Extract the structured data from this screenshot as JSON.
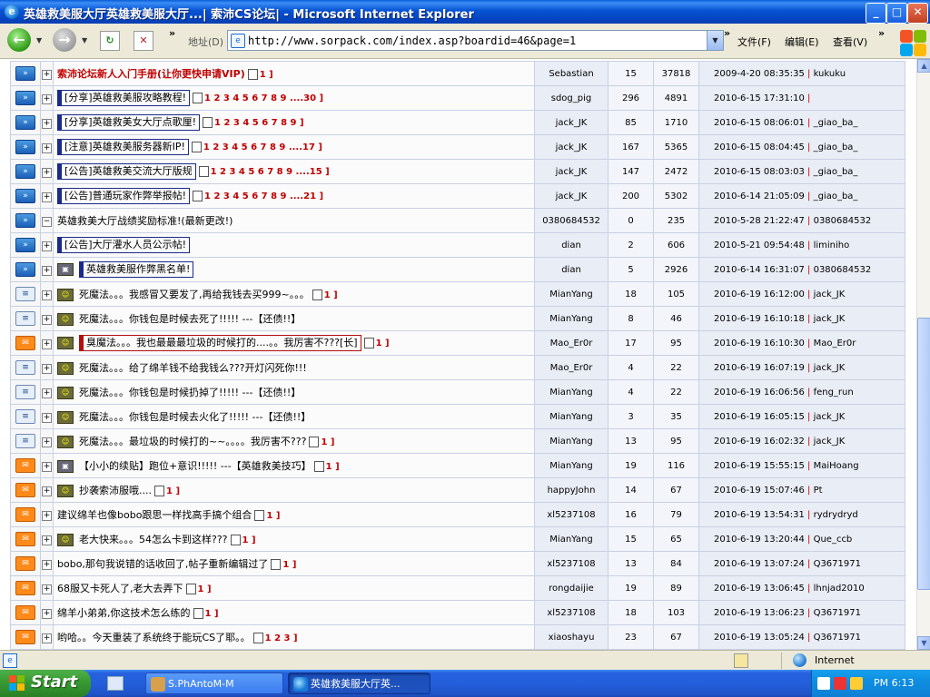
{
  "window": {
    "title": "英雄救美服大厅英雄救美服大厅...| 索沛CS论坛| - Microsoft Internet Explorer",
    "minimize": "_",
    "maximize": "□",
    "close": "✕"
  },
  "toolbar": {
    "address_label": "地址(D)",
    "url": "http://www.sorpack.com/index.asp?boardid=46&page=1",
    "menus": [
      "文件(F)",
      "编辑(E)",
      "查看(V)"
    ]
  },
  "threads": [
    {
      "icon": "green",
      "expander": "+",
      "tag": "",
      "frame": "",
      "title": "索沛论坛新人入门手册(让你更快申请VIP)",
      "title_style": "red",
      "pages": "",
      "attach": true,
      "author": "Sebastian",
      "replies": "15",
      "views": "37818",
      "last_time": "2009-4-20 08:35:35",
      "last_user": "kukuku"
    },
    {
      "icon": "green",
      "expander": "+",
      "tag": "",
      "frame": "blue",
      "title": "[分享]英雄救美服攻略教程!",
      "title_style": "",
      "pages": "1 2 3 4 5 6 7 8 9 ....30",
      "attach": false,
      "author": "sdog_pig",
      "replies": "296",
      "views": "4891",
      "last_time": "2010-6-15 17:31:10",
      "last_user": ""
    },
    {
      "icon": "green",
      "expander": "+",
      "tag": "",
      "frame": "blue",
      "title": "[分享]英雄救美女大厅点歌厘!",
      "title_style": "",
      "pages": "1 2 3 4 5 6 7 8 9",
      "attach": false,
      "author": "jack_JK",
      "replies": "85",
      "views": "1710",
      "last_time": "2010-6-15 08:06:01",
      "last_user": "_giao_ba_"
    },
    {
      "icon": "green",
      "expander": "+",
      "tag": "",
      "frame": "blue",
      "title": "[注意]英雄救美服务器新IP!",
      "title_style": "",
      "pages": "1 2 3 4 5 6 7 8 9 ....17",
      "attach": false,
      "author": "jack_JK",
      "replies": "167",
      "views": "5365",
      "last_time": "2010-6-15 08:04:45",
      "last_user": "_giao_ba_"
    },
    {
      "icon": "green",
      "expander": "+",
      "tag": "",
      "frame": "blue",
      "title": "[公告]英雄救美交流大厅版规",
      "title_style": "",
      "pages": "1 2 3 4 5 6 7 8 9 ....15",
      "attach": false,
      "author": "jack_JK",
      "replies": "147",
      "views": "2472",
      "last_time": "2010-6-15 08:03:03",
      "last_user": "_giao_ba_"
    },
    {
      "icon": "green",
      "expander": "+",
      "tag": "",
      "frame": "blue",
      "title": "[公告]普通玩家作弊举报帖!",
      "title_style": "",
      "pages": "1 2 3 4 5 6 7 8 9 ....21",
      "attach": false,
      "author": "jack_JK",
      "replies": "200",
      "views": "5302",
      "last_time": "2010-6-14 21:05:09",
      "last_user": "_giao_ba_"
    },
    {
      "icon": "green",
      "expander": "−",
      "tag": "",
      "frame": "",
      "title": "英雄救美大厅战绩奖励标准!(最新更改!)",
      "title_style": "",
      "pages": "",
      "attach": false,
      "author": "0380684532",
      "replies": "0",
      "views": "235",
      "last_time": "2010-5-28 21:22:47",
      "last_user": "0380684532"
    },
    {
      "icon": "green",
      "expander": "+",
      "tag": "",
      "frame": "blue",
      "title": "[公告]大厅灌水人员公示帖!",
      "title_style": "",
      "pages": "",
      "attach": false,
      "author": "dian",
      "replies": "2",
      "views": "606",
      "last_time": "2010-5-21 09:54:48",
      "last_user": "liminiho"
    },
    {
      "icon": "green",
      "expander": "+",
      "tag": "gray",
      "frame": "blue",
      "title": "英雄救美服作弊黑名单!",
      "title_style": "",
      "pages": "",
      "attach": false,
      "author": "dian",
      "replies": "5",
      "views": "2926",
      "last_time": "2010-6-14 16:31:07",
      "last_user": "0380684532"
    },
    {
      "icon": "doc",
      "expander": "+",
      "tag": "ok",
      "frame": "",
      "title": "死魔法。。。我感冒又要发了,再给我钱去买999~。。。",
      "title_style": "",
      "pages": "",
      "attach": true,
      "author": "MianYang",
      "replies": "18",
      "views": "105",
      "last_time": "2010-6-19 16:12:00",
      "last_user": "jack_JK"
    },
    {
      "icon": "doc",
      "expander": "+",
      "tag": "ok",
      "frame": "",
      "title": "死魔法。。。你钱包是时候去死了!!!!! ---【还债!!】",
      "title_style": "",
      "pages": "",
      "attach": false,
      "author": "MianYang",
      "replies": "8",
      "views": "46",
      "last_time": "2010-6-19 16:10:18",
      "last_user": "jack_JK"
    },
    {
      "icon": "env",
      "expander": "+",
      "tag": "ok",
      "frame": "red",
      "title": "臭魔法。。。我也最最最垃圾的时候打的....。。我厉害不???[长]",
      "title_style": "",
      "pages": "",
      "attach": true,
      "author": "Mao_Er0r",
      "replies": "17",
      "views": "95",
      "last_time": "2010-6-19 16:10:30",
      "last_user": "Mao_Er0r"
    },
    {
      "icon": "doc",
      "expander": "+",
      "tag": "ok",
      "frame": "",
      "title": "死魔法。。。给了绵羊钱不给我钱么???开灯闪死你!!!",
      "title_style": "",
      "pages": "",
      "attach": false,
      "author": "Mao_Er0r",
      "replies": "4",
      "views": "22",
      "last_time": "2010-6-19 16:07:19",
      "last_user": "jack_JK"
    },
    {
      "icon": "doc",
      "expander": "+",
      "tag": "ok",
      "frame": "",
      "title": "死魔法。。。你钱包是时候扔掉了!!!!! ---【还债!!】",
      "title_style": "",
      "pages": "",
      "attach": false,
      "author": "MianYang",
      "replies": "4",
      "views": "22",
      "last_time": "2010-6-19 16:06:56",
      "last_user": "feng_run"
    },
    {
      "icon": "doc",
      "expander": "+",
      "tag": "ok",
      "frame": "",
      "title": "死魔法。。。你钱包是时候去火化了!!!!! ---【还债!!】",
      "title_style": "",
      "pages": "",
      "attach": false,
      "author": "MianYang",
      "replies": "3",
      "views": "35",
      "last_time": "2010-6-19 16:05:15",
      "last_user": "jack_JK"
    },
    {
      "icon": "doc",
      "expander": "+",
      "tag": "ok",
      "frame": "",
      "title": "死魔法。。。最垃圾的时候打的~~。。。。我厉害不???",
      "title_style": "",
      "pages": "",
      "attach": true,
      "author": "MianYang",
      "replies": "13",
      "views": "95",
      "last_time": "2010-6-19 16:02:32",
      "last_user": "jack_JK"
    },
    {
      "icon": "env",
      "expander": "+",
      "tag": "gray",
      "frame": "",
      "title": "【小小的续贴】跑位+意识!!!!! ---【英雄救美技巧】",
      "title_style": "",
      "pages": "",
      "attach": true,
      "author": "MianYang",
      "replies": "19",
      "views": "116",
      "last_time": "2010-6-19 15:55:15",
      "last_user": "MaiHoang"
    },
    {
      "icon": "env",
      "expander": "+",
      "tag": "ok",
      "frame": "",
      "title": "抄袭索沛服哦....",
      "title_style": "",
      "pages": "",
      "attach": true,
      "author": "happyJohn",
      "replies": "14",
      "views": "67",
      "last_time": "2010-6-19 15:07:46",
      "last_user": "Pt"
    },
    {
      "icon": "env",
      "expander": "+",
      "tag": "",
      "frame": "",
      "title": "建议绵羊也像bobo跟思一样找高手搞个组合",
      "title_style": "",
      "pages": "",
      "attach": true,
      "author": "xl5237108",
      "replies": "16",
      "views": "79",
      "last_time": "2010-6-19 13:54:31",
      "last_user": "rydrydryd"
    },
    {
      "icon": "env",
      "expander": "+",
      "tag": "ok",
      "frame": "",
      "title": "老大快来。。。54怎么卡到这样???",
      "title_style": "",
      "pages": "",
      "attach": true,
      "author": "MianYang",
      "replies": "15",
      "views": "65",
      "last_time": "2010-6-19 13:20:44",
      "last_user": "Que_ccb"
    },
    {
      "icon": "env",
      "expander": "+",
      "tag": "",
      "frame": "",
      "title": "bobo,那句我说错的话收回了,帖子重新编辑过了",
      "title_style": "",
      "pages": "",
      "attach": true,
      "author": "xl5237108",
      "replies": "13",
      "views": "84",
      "last_time": "2010-6-19 13:07:24",
      "last_user": "Q3671971"
    },
    {
      "icon": "env",
      "expander": "+",
      "tag": "",
      "frame": "",
      "title": "68服又卡死人了,老大去弄下",
      "title_style": "",
      "pages": "",
      "attach": true,
      "author": "rongdaijie",
      "replies": "19",
      "views": "89",
      "last_time": "2010-6-19 13:06:45",
      "last_user": "lhnjad2010"
    },
    {
      "icon": "env",
      "expander": "+",
      "tag": "",
      "frame": "",
      "title": "绵羊小弟弟,你这技术怎么练的",
      "title_style": "",
      "pages": "",
      "attach": true,
      "author": "xl5237108",
      "replies": "18",
      "views": "103",
      "last_time": "2010-6-19 13:06:23",
      "last_user": "Q3671971"
    },
    {
      "icon": "env",
      "expander": "+",
      "tag": "",
      "frame": "",
      "title": "哟哈。。今天重装了系统终于能玩CS了耶。。",
      "title_style": "",
      "pages": "1 2 3",
      "attach": true,
      "author": "xiaoshayu",
      "replies": "23",
      "views": "67",
      "last_time": "2010-6-19 13:05:24",
      "last_user": "Q3671971"
    }
  ],
  "statusbar": {
    "zone_text": "Internet"
  },
  "taskbar": {
    "start_label": "Start",
    "tasks": [
      "S.PhAntoM-M",
      "英雄救美服大厅英..."
    ],
    "clock": "PM 6:13"
  },
  "colors": {
    "title_bar": "#0753d4",
    "accent_red": "#c00000",
    "frame_blue": "#1a2a8a",
    "taskbar": "#245edb"
  }
}
